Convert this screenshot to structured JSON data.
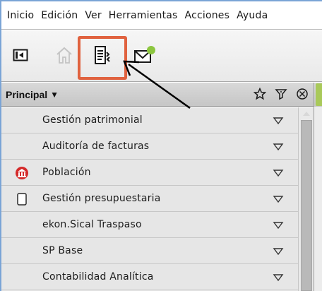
{
  "menubar": {
    "items": [
      "Inicio",
      "Edición",
      "Ver",
      "Herramientas",
      "Acciones",
      "Ayuda"
    ]
  },
  "toolbar": {
    "buttons": [
      {
        "icon": "panel-collapse-icon"
      },
      {
        "icon": "home-icon",
        "disabled": true
      },
      {
        "icon": "document-list-icon",
        "highlighted": true
      },
      {
        "icon": "mail-notification-icon",
        "badge_color": "#8cc63f"
      }
    ],
    "highlight_color": "#e0623f"
  },
  "panel": {
    "title": "Principal",
    "header_icons": [
      "star-icon",
      "filter-icon",
      "close-circle-icon"
    ]
  },
  "list": {
    "items": [
      {
        "label": "Gestión patrimonial",
        "icon": ""
      },
      {
        "label": "Auditoría de facturas",
        "icon": ""
      },
      {
        "label": "Población",
        "icon": "town-hall-icon"
      },
      {
        "label": "Gestión presupuestaria",
        "icon": "checkbox-icon"
      },
      {
        "label": "ekon.Sical Traspaso",
        "icon": ""
      },
      {
        "label": "SP Base",
        "icon": ""
      },
      {
        "label": "Contabilidad Analítica",
        "icon": ""
      }
    ]
  },
  "colors": {
    "accent_border": "#7aa4d6",
    "list_background": "#e6e6e6",
    "poblacion_icon": "#d42a2a"
  }
}
